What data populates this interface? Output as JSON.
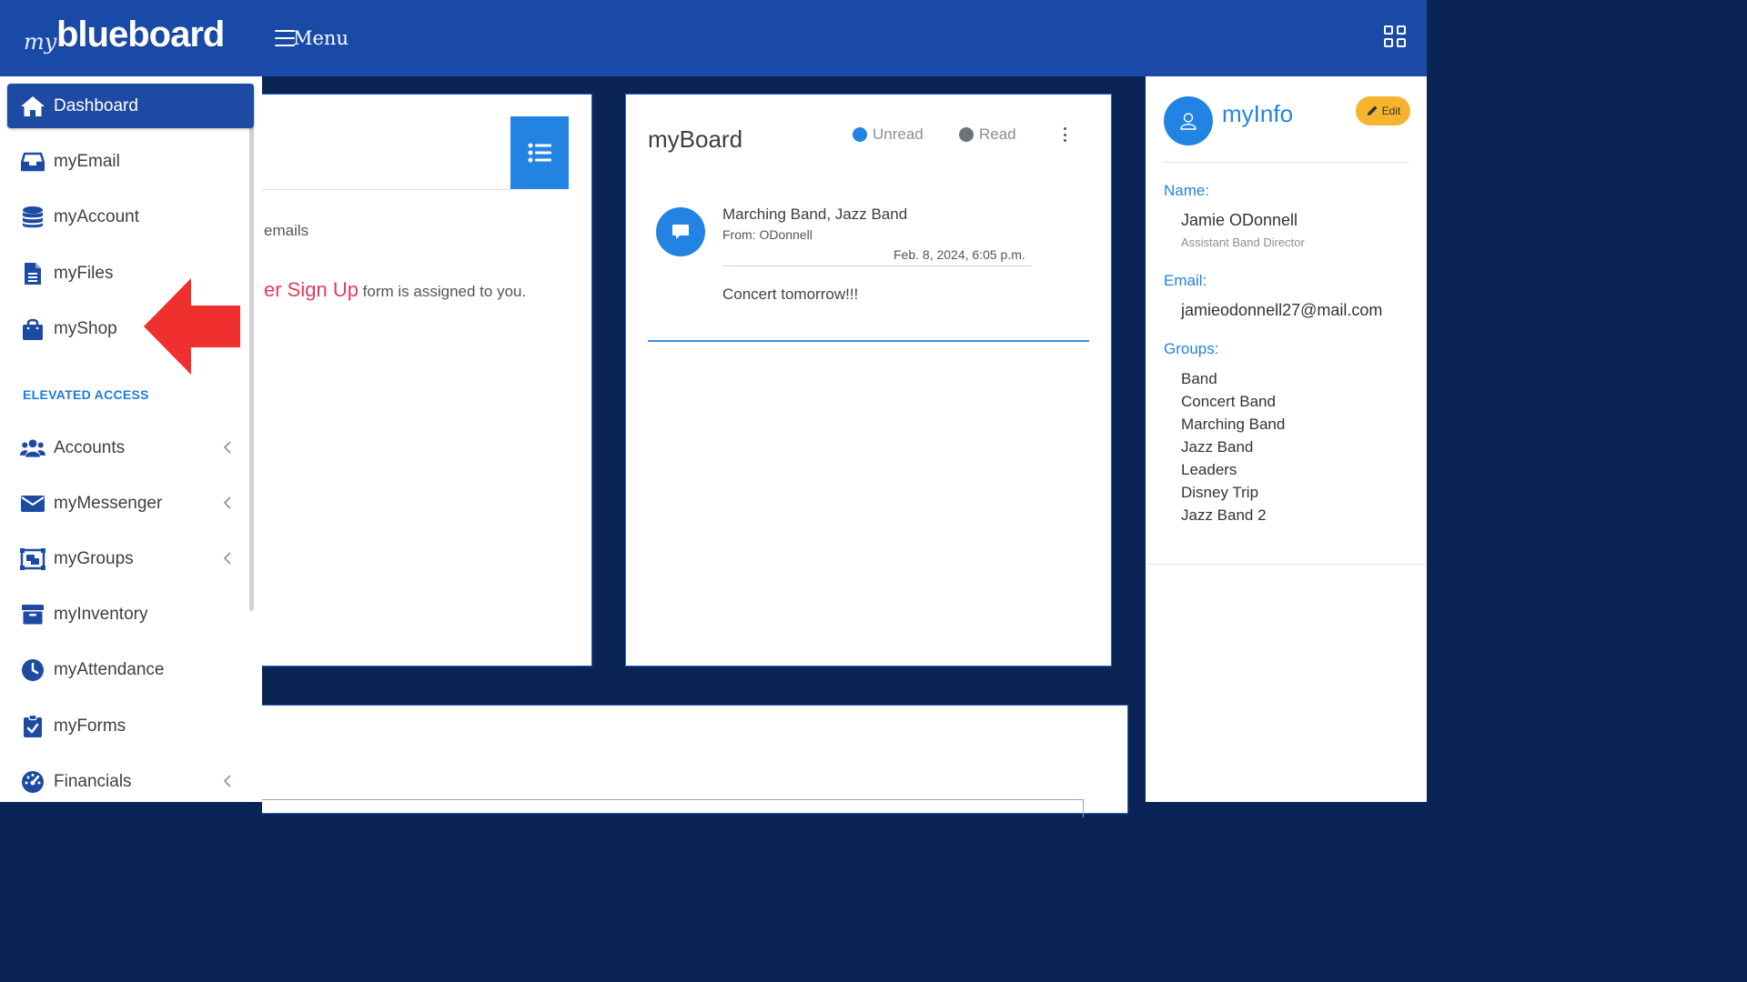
{
  "topbar": {
    "logo_prefix": "my",
    "logo_name": "blueboard",
    "menu_label": "Menu"
  },
  "sidebar": {
    "items": [
      {
        "label": "Dashboard",
        "icon": "home-icon",
        "active": true
      },
      {
        "label": "myEmail",
        "icon": "inbox-icon"
      },
      {
        "label": "myAccount",
        "icon": "database-icon"
      },
      {
        "label": "myFiles",
        "icon": "file-icon"
      },
      {
        "label": "myShop",
        "icon": "shopping-bag-icon"
      }
    ],
    "section_title": "ELEVATED ACCESS",
    "elevated_items": [
      {
        "label": "Accounts",
        "icon": "users-icon",
        "expandable": true
      },
      {
        "label": "myMessenger",
        "icon": "envelope-icon",
        "expandable": true
      },
      {
        "label": "myGroups",
        "icon": "groups-icon",
        "expandable": true
      },
      {
        "label": "myInventory",
        "icon": "archive-icon"
      },
      {
        "label": "myAttendance",
        "icon": "clock-icon"
      },
      {
        "label": "myForms",
        "icon": "clipboard-check-icon"
      },
      {
        "label": "Financials",
        "icon": "gauge-icon",
        "expandable": true
      }
    ]
  },
  "emails_card": {
    "line1": "emails",
    "line2_link": "er Sign Up",
    "line2_rest": " form is assigned to you."
  },
  "board": {
    "title": "myBoard",
    "legend": [
      {
        "label": "Unread",
        "color": "#2383e2"
      },
      {
        "label": "Read",
        "color": "#6c737b"
      }
    ],
    "message": {
      "groups": "Marching Band, Jazz Band",
      "from": "From: ODonnell",
      "date": "Feb. 8, 2024, 6:05 p.m.",
      "body": "Concert tomorrow!!!"
    }
  },
  "info": {
    "title": "myInfo",
    "edit_label": "Edit",
    "name_label": "Name:",
    "name": "Jamie ODonnell",
    "role": "Assistant Band Director",
    "email_label": "Email:",
    "email": "jamieodonnell27@mail.com",
    "groups_label": "Groups:",
    "groups": [
      "Band",
      "Concert Band",
      "Marching Band",
      "Jazz Band",
      "Leaders",
      "Disney Trip",
      "Jazz Band 2"
    ]
  },
  "colors": {
    "topbar": "#1a4aa8",
    "accent": "#2383e2",
    "background": "#0a2555",
    "arrow": "#f0302e",
    "edit": "#f6b32e"
  }
}
